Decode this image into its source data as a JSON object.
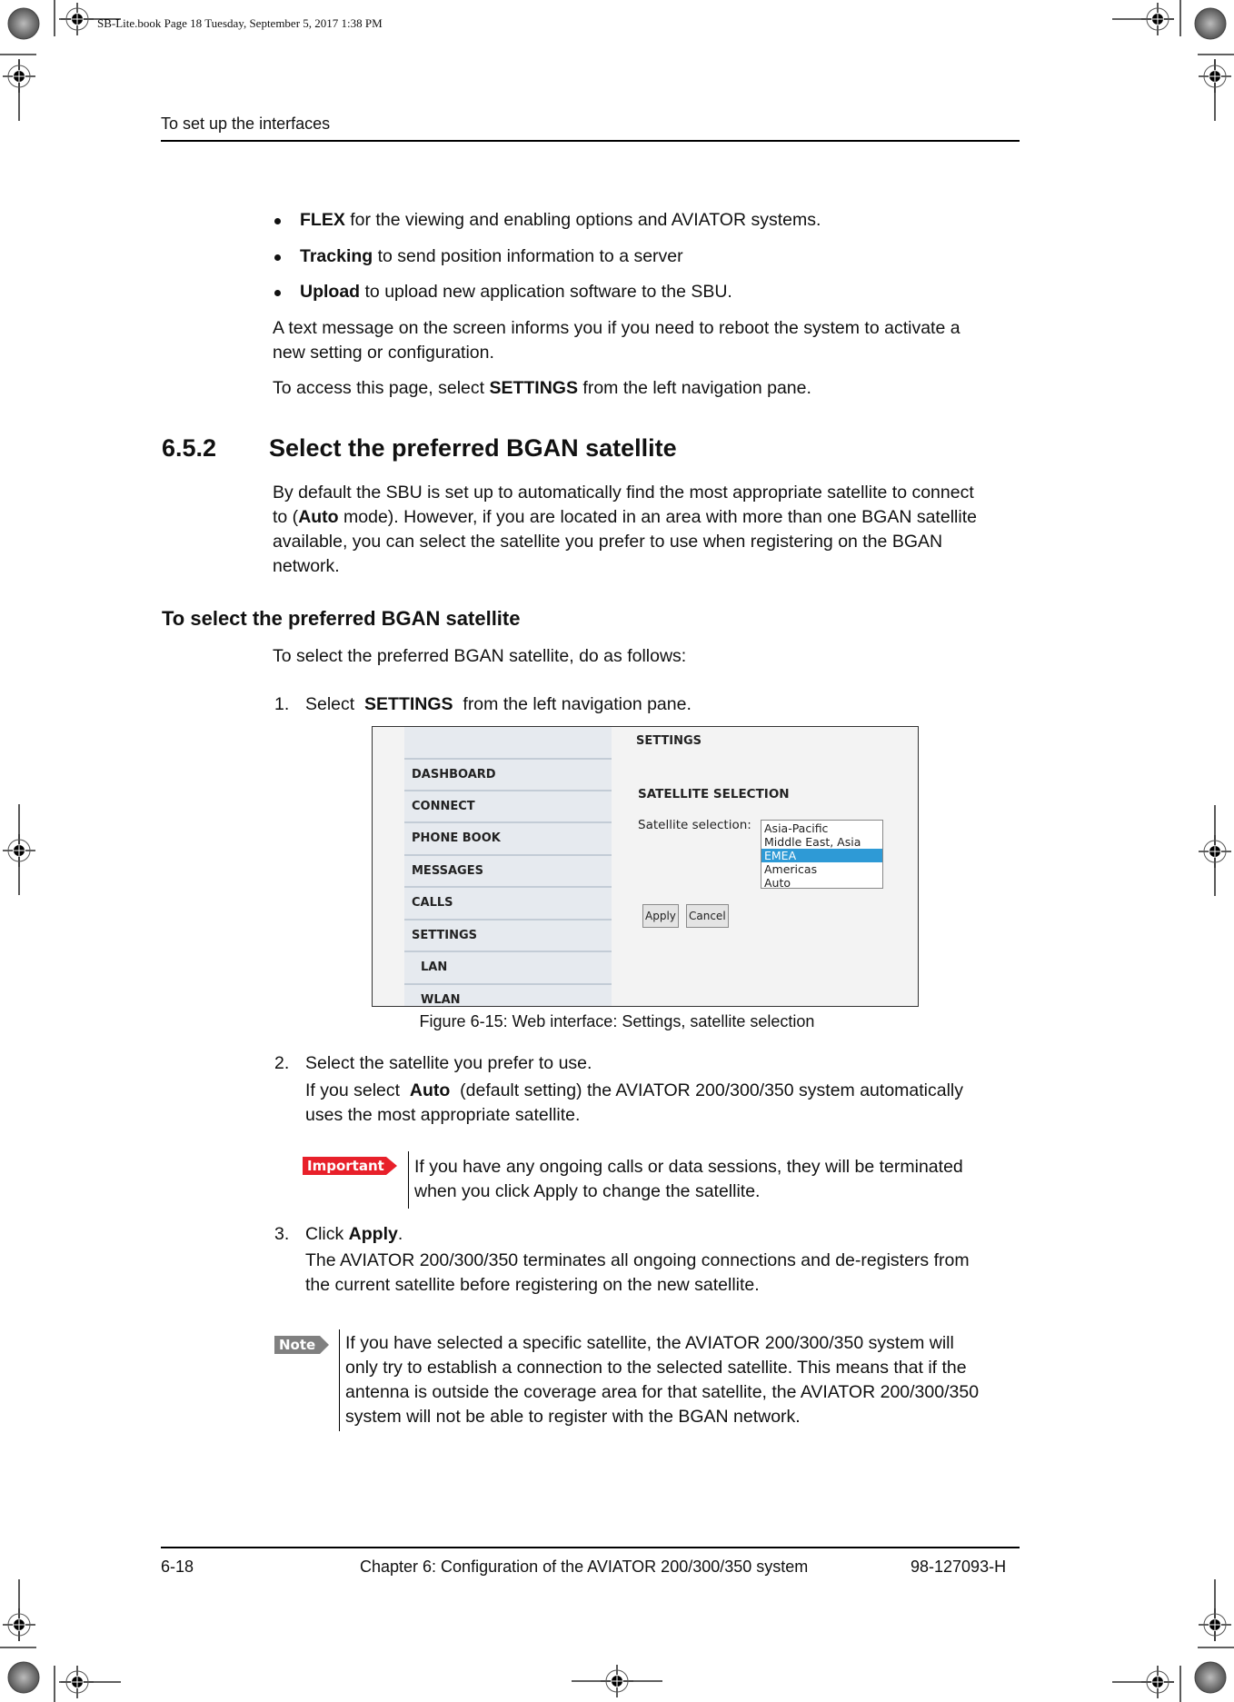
{
  "slug": "SB-Lite.book  Page 18  Tuesday, September 5, 2017  1:38 PM",
  "running_head": "To set up the interfaces",
  "bullets": [
    {
      "bold": "FLEX",
      "text": " for the viewing and enabling options and AVIATOR systems."
    },
    {
      "bold": "Tracking",
      "text": " to send position information to a server"
    },
    {
      "bold": "Upload",
      "text": " to upload new application software to the SBU."
    }
  ],
  "para_reboot": [
    "A text message on the screen informs you if you need to reboot the system to activate a",
    "new setting or configuration."
  ],
  "para_access": {
    "pre": "To access this page, select ",
    "bold": "SETTINGS",
    "post": " from the left navigation pane."
  },
  "section": {
    "number": "6.5.2",
    "title": "Select the preferred BGAN satellite"
  },
  "section_body": {
    "line1": "By default the SBU is set up to automatically find the most appropriate satellite to connect",
    "line2_pre": "to (",
    "line2_bold": "Auto",
    "line2_post": " mode). However, if you are located in an area with more than one BGAN satellite",
    "line3": "available, you can select the satellite you prefer to use when registering on the BGAN",
    "line4": "network."
  },
  "subheading": "To select the preferred BGAN satellite",
  "intro": "To select the preferred BGAN satellite, do as follows:",
  "steps": [
    {
      "num": "1.",
      "pre": "Select  ",
      "bold": "SETTINGS",
      "post": "  from the left navigation pane."
    },
    {
      "num": "2.",
      "line1": "Select the satellite you prefer to use.",
      "line2_pre": "If you select  ",
      "line2_bold": "Auto",
      "line2_post": "  (default setting) the AVIATOR 200/300/350 system automatically",
      "line3": "uses the most appropriate satellite."
    },
    {
      "num": "3.",
      "pre": "Click ",
      "bold": "Apply",
      "post": ".",
      "line2": "The AVIATOR 200/300/350 terminates all ongoing connections and de-registers from",
      "line3": "the current satellite before registering on the new satellite."
    }
  ],
  "figure": {
    "nav_items": [
      "DASHBOARD",
      "CONNECT",
      "PHONE BOOK",
      "MESSAGES",
      "CALLS",
      "SETTINGS",
      "LAN",
      "WLAN"
    ],
    "page_title": "SETTINGS",
    "section_title": "SATELLITE SELECTION",
    "field_label": "Satellite selection:",
    "options": [
      "Asia-Pacific",
      "Middle East, Asia",
      "EMEA",
      "Americas",
      "Auto"
    ],
    "selected_option": "EMEA",
    "apply_label": "Apply",
    "cancel_label": "Cancel",
    "selection_color": "#2e9ad6",
    "caption": "Figure 6-15: Web interface: Settings, satellite selection"
  },
  "important": {
    "label": "Important",
    "color": "#e8202a",
    "line1": "If you have any ongoing calls or data sessions, they will be terminated",
    "line2": "when you click Apply to change the satellite."
  },
  "note": {
    "label": "Note",
    "color": "#808080",
    "lines": [
      "If you have selected a specific satellite, the AVIATOR 200/300/350 system will",
      "only try to establish a connection to the selected satellite. This means that if the",
      "antenna is outside the coverage area for that satellite, the AVIATOR 200/300/350",
      "system will not be able to register with the BGAN network."
    ]
  },
  "footer": {
    "page": "6-18",
    "chapter": "Chapter 6:  Configuration of the AVIATOR 200/300/350 system",
    "doc_number": "98-127093-H"
  }
}
